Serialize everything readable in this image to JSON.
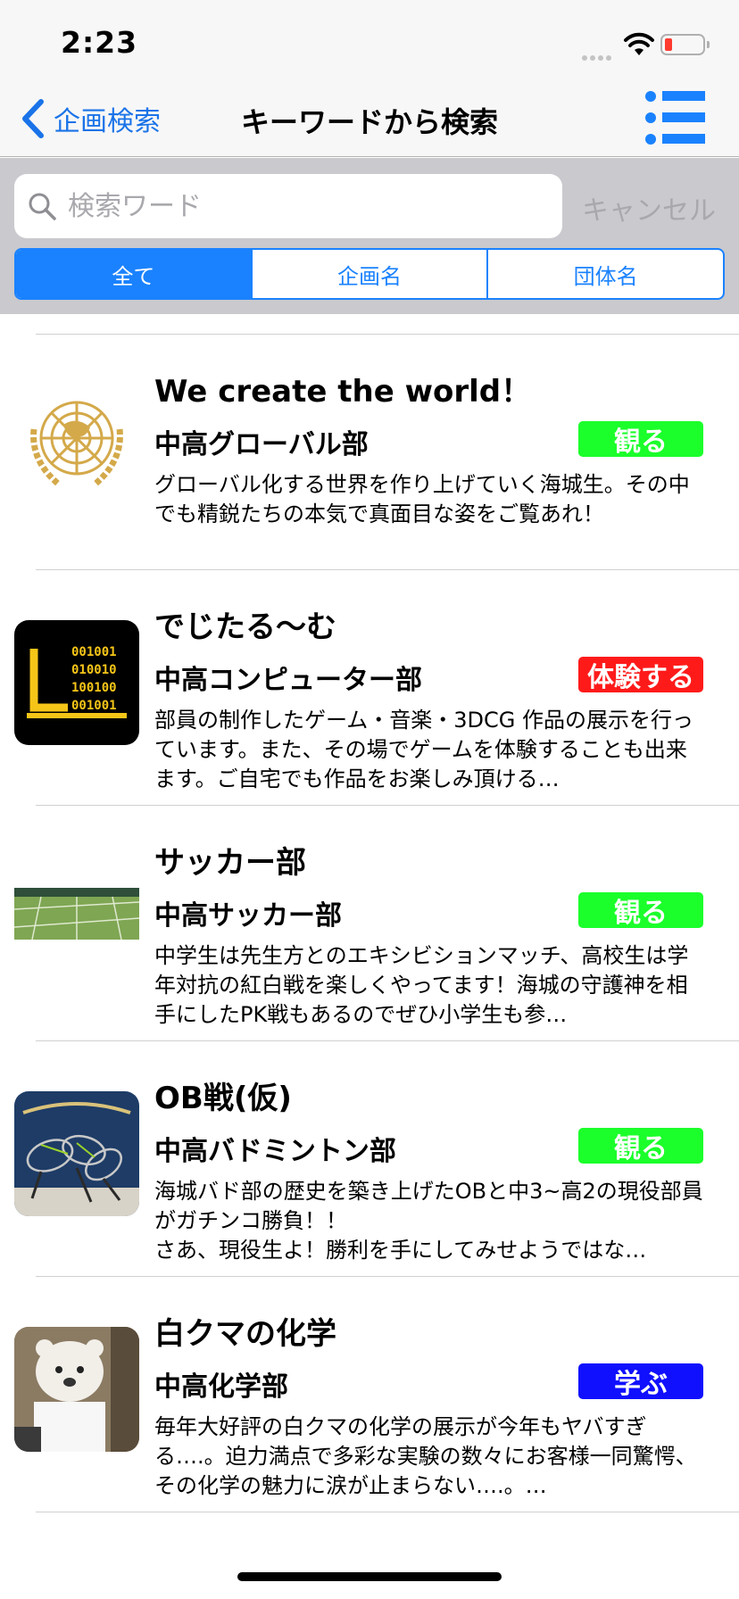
{
  "status": {
    "time": "2:23"
  },
  "nav": {
    "back_label": "企画検索",
    "title": "キーワードから検索"
  },
  "search": {
    "placeholder": "検索ワード",
    "value": "",
    "cancel_label": "キャンセル"
  },
  "segments": [
    "全て",
    "企画名",
    "団体名"
  ],
  "colors": {
    "accent": "#1a82ff",
    "watch": "#1bff2b",
    "experience": "#ff1a1a",
    "learn": "#1010ff"
  },
  "items": [
    {
      "title": "We create the world！",
      "group": "中高グローバル部",
      "badge": "観る",
      "desc": "グローバル化する世界を作り上げていく海城生。その中でも精鋭たちの本気で真面目な姿をご覧あれ！",
      "icon": "globe-emblem-icon"
    },
    {
      "title": "でじたる〜む",
      "group": "中高コンピューター部",
      "badge": "体験する",
      "desc": "部員の制作したゲーム・音楽・3DCG 作品の展示を行っています。また、その場でゲームを体験することも出来ます。ご自宅でも作品をお楽しみ頂ける…",
      "icon": "computer-binary-icon",
      "binary": [
        "001001",
        "010010",
        "100100",
        "001001"
      ]
    },
    {
      "title": "サッカー部",
      "group": "中高サッカー部",
      "badge": "観る",
      "desc": "中学生は先生方とのエキシビションマッチ、高校生は学年対抗の紅白戦を楽しくやってます！海城の守護神を相手にしたPK戦もあるのでぜひ小学生も参…",
      "icon": "soccer-field-photo"
    },
    {
      "title": "OB戦(仮)",
      "group": "中高バドミントン部",
      "badge": "観る",
      "desc": "海城バド部の歴史を築き上げたOBと中3~高2の現役部員がガチンコ勝負！！\nさあ、現役生よ！勝利を手にしてみせようではな…",
      "icon": "badminton-rackets-photo"
    },
    {
      "title": "白クマの化学",
      "group": "中高化学部",
      "badge": "学ぶ",
      "desc": "毎年大好評の白クマの化学の展示が今年もヤバすぎる….。迫力満点で多彩な実験の数々にお客様一同驚愕、その化学の魅力に涙が止まらない….。…",
      "icon": "polar-bear-costume-photo"
    }
  ]
}
